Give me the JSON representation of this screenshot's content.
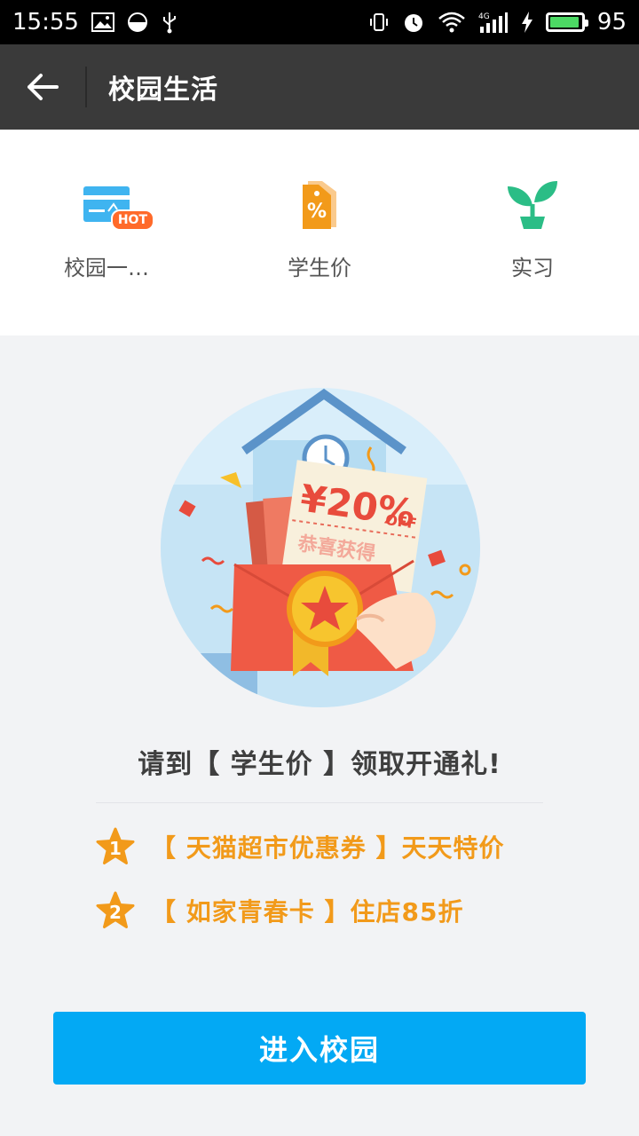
{
  "status_bar": {
    "time": "15:55",
    "battery_level": 95,
    "battery_text": "95",
    "network": "4G"
  },
  "nav": {
    "title": "校园生活"
  },
  "quick_menu": {
    "items": [
      {
        "label": "校园一…",
        "icon": "campus-card-icon",
        "badge": "HOT"
      },
      {
        "label": "学生价",
        "icon": "discount-tag-icon"
      },
      {
        "label": "实习",
        "icon": "sprout-icon"
      }
    ]
  },
  "hero": {
    "coupon_amount": "¥20%",
    "coupon_off": "OFF",
    "coupon_caption": "恭喜获得"
  },
  "headline": "请到【 学生价 】领取开通礼!",
  "benefits": [
    {
      "num": "1",
      "text": "【 天猫超市优惠券 】天天特价"
    },
    {
      "num": "2",
      "text": "【 如家青春卡 】住店85折"
    }
  ],
  "enter_button": "进入校园",
  "colors": {
    "accent": "#03a9f4",
    "benefit": "#f29a1a",
    "nav": "#3a3a3a",
    "hot": "#ff6a2a"
  }
}
